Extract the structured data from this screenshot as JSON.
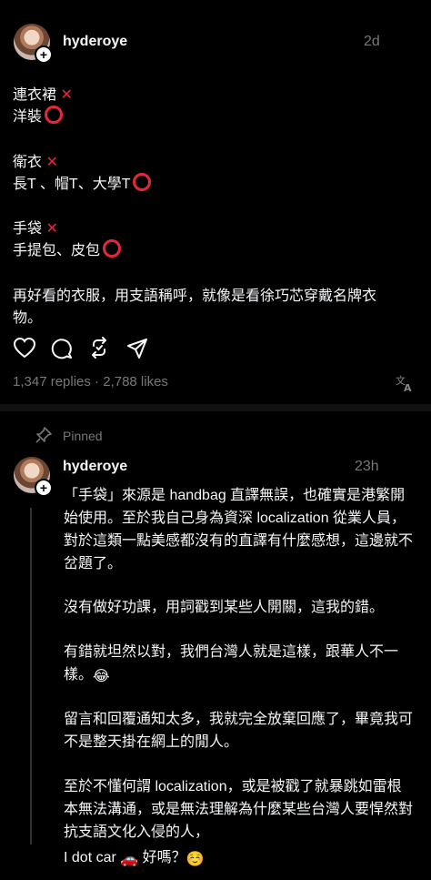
{
  "post": {
    "username": "hyderoye",
    "time": "2d",
    "lines": [
      "連衣裙",
      "洋裝",
      "衛衣",
      "長T 、帽T、大學T",
      "手袋",
      "手提包、皮包",
      "再好看的衣服，用支語稱呼，就像是看徐巧芯穿戴名牌衣",
      "物。"
    ],
    "replies_likes": "1,347 replies · 2,788 likes"
  },
  "reply": {
    "pinned_label": "Pinned",
    "username": "hyderoye",
    "time": "23h",
    "lines": [
      "「手袋」來源是 handbag 直譯無誤，也確實是港繁開",
      "始使用。至於我自己身為資深 localization 從業人員，",
      "對於這類一點美感都沒有的直譯有什麼感想，這邊就不",
      "岔題了。",
      "沒有做好功課，用詞戳到某些人開關，這我的錯。",
      "有錯就坦然以對，我們台灣人就是這樣，跟華人不一",
      "樣。",
      "留言和回覆通知太多，我就完全放棄回應了，畢竟我可",
      "不是整天掛在網上的閒人。",
      "至於不懂何謂 localization，或是被戳了就暴跳如雷根",
      "本無法溝通，或是無法理解為什麼某些台灣人要悍然對",
      "抗支語文化入侵的人，",
      "I dot car",
      "好嗎？"
    ]
  },
  "colors": {
    "background": "#000000",
    "text": "#f3f5f7",
    "muted": "#777777",
    "accent_red": "#e8263a"
  }
}
